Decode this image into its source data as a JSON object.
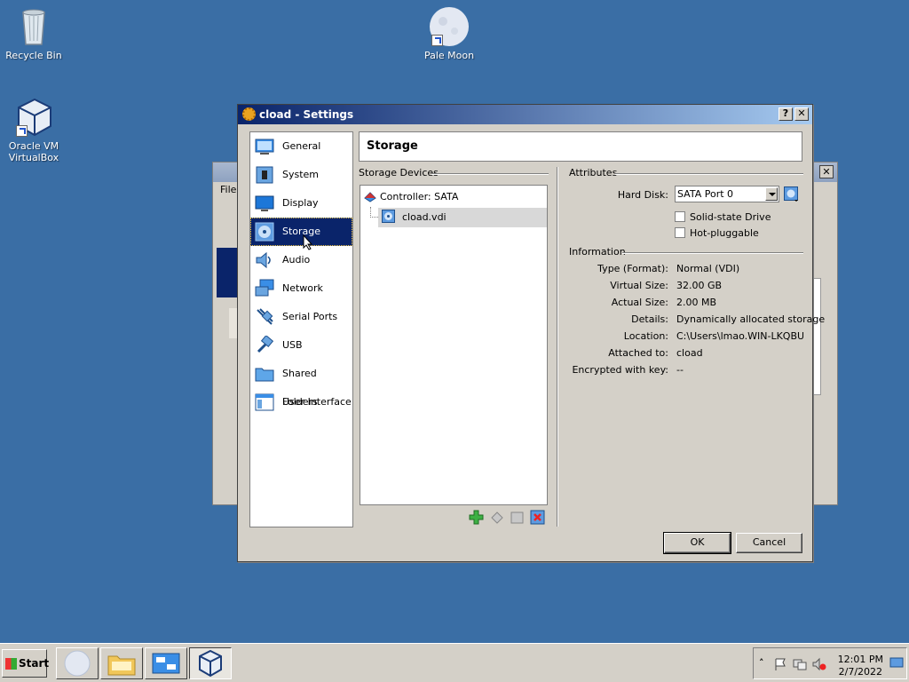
{
  "desktop": {
    "icons": [
      {
        "label": "Recycle Bin",
        "icon": "recycle-bin-icon"
      },
      {
        "label": "Pale Moon",
        "icon": "pale-moon-icon"
      },
      {
        "label": "Oracle VM VirtualBox",
        "icon": "virtualbox-icon"
      }
    ]
  },
  "bg_window": {
    "menu_file": "File"
  },
  "dialog": {
    "title": "cload - Settings",
    "help_button": "?",
    "close_button": "✕",
    "nav": [
      {
        "label": "General",
        "icon": "general-icon"
      },
      {
        "label": "System",
        "icon": "system-icon"
      },
      {
        "label": "Display",
        "icon": "display-icon"
      },
      {
        "label": "Storage",
        "icon": "storage-icon",
        "selected": true
      },
      {
        "label": "Audio",
        "icon": "audio-icon"
      },
      {
        "label": "Network",
        "icon": "network-icon"
      },
      {
        "label": "Serial Ports",
        "icon": "serial-ports-icon"
      },
      {
        "label": "USB",
        "icon": "usb-icon"
      },
      {
        "label": "Shared Folders",
        "icon": "shared-folders-icon"
      },
      {
        "label": "User Interface",
        "icon": "user-interface-icon"
      }
    ],
    "section_title": "Storage",
    "storage_devices_label": "Storage Devices",
    "tree": {
      "controller": "Controller: SATA",
      "disk": "cload.vdi"
    },
    "attributes": {
      "group_label": "Attributes",
      "hard_disk_label": "Hard Disk:",
      "hard_disk_value": "SATA Port 0",
      "solid_state_label": "Solid-state Drive",
      "solid_state_checked": false,
      "hot_pluggable_label": "Hot-pluggable",
      "hot_pluggable_checked": false
    },
    "information": {
      "group_label": "Information",
      "rows": [
        {
          "label": "Type (Format):",
          "value": "Normal (VDI)"
        },
        {
          "label": "Virtual Size:",
          "value": "32.00 GB"
        },
        {
          "label": "Actual Size:",
          "value": "2.00 MB"
        },
        {
          "label": "Details:",
          "value": "Dynamically allocated storage"
        },
        {
          "label": "Location:",
          "value": "C:\\Users\\lmao.WIN-LKQBU..."
        },
        {
          "label": "Attached to:",
          "value": "cload"
        },
        {
          "label": "Encrypted with key:",
          "value": "--"
        }
      ]
    },
    "ok_label": "OK",
    "cancel_label": "Cancel"
  },
  "taskbar": {
    "start_label": "Start",
    "time": "12:01 PM",
    "date": "2/7/2022"
  },
  "colors": {
    "desktop": "#3a6ea5",
    "selection": "#0a246a",
    "dialog_face": "#d4d0c8"
  }
}
